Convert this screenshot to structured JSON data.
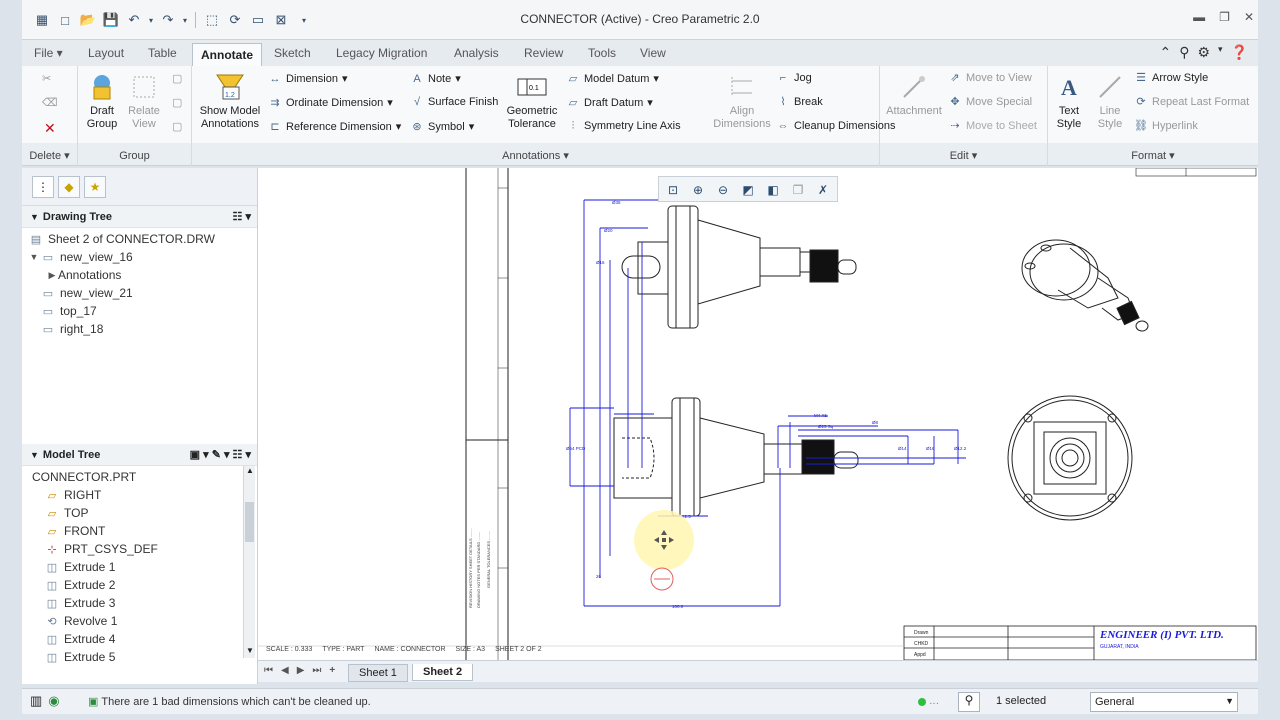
{
  "window": {
    "title": "CONNECTOR (Active) - Creo Parametric 2.0"
  },
  "tabs": [
    "File",
    "Layout",
    "Table",
    "Annotate",
    "Sketch",
    "Legacy Migration",
    "Analysis",
    "Review",
    "Tools",
    "View"
  ],
  "ribbon": {
    "delete_group": {
      "label": "Delete"
    },
    "group_group": {
      "label": "Group",
      "draft_group": "Draft Group",
      "relate_view": "Relate View"
    },
    "annotations_group": {
      "label": "Annotations",
      "show_model_annotations": "Show Model Annotations",
      "dimension": "Dimension",
      "ordinate_dimension": "Ordinate Dimension",
      "reference_dimension": "Reference Dimension",
      "note": "Note",
      "surface_finish": "Surface Finish",
      "symbol": "Symbol",
      "geometric_tolerance": "Geometric Tolerance",
      "model_datum": "Model Datum",
      "draft_datum": "Draft Datum",
      "symmetry_line_axis": "Symmetry Line Axis",
      "align_dimensions": "Align Dimensions",
      "jog": "Jog",
      "break": "Break",
      "cleanup_dimensions": "Cleanup Dimensions"
    },
    "edit_group": {
      "label": "Edit",
      "attachment": "Attachment",
      "move_to_view": "Move to View",
      "move_special": "Move Special",
      "move_to_sheet": "Move to Sheet"
    },
    "format_group": {
      "label": "Format",
      "text_style": "Text Style",
      "line_style": "Line Style",
      "arrow_style": "Arrow Style",
      "repeat_last_format": "Repeat Last Format",
      "hyperlink": "Hyperlink"
    }
  },
  "drawing_tree": {
    "title": "Drawing Tree",
    "items": [
      "Sheet 2 of CONNECTOR.DRW",
      "new_view_16",
      "Annotations",
      "new_view_21",
      "top_17",
      "right_18"
    ]
  },
  "model_tree": {
    "title": "Model Tree",
    "root": "CONNECTOR.PRT",
    "items": [
      "RIGHT",
      "TOP",
      "FRONT",
      "PRT_CSYS_DEF",
      "Extrude 1",
      "Extrude 2",
      "Extrude 3",
      "Revolve 1",
      "Extrude 4",
      "Extrude 5"
    ]
  },
  "drawing": {
    "footer_scale": "SCALE : 0.333",
    "footer_type": "TYPE : PART",
    "footer_name": "NAME : CONNECTOR",
    "footer_size": "SIZE : A3",
    "footer_sheet": "SHEET 2 OF 2",
    "company": "ENGINEER (I) PVT. LTD.",
    "company_sub": "GUJARAT, INDIA",
    "title_rows": [
      "Drawn",
      "CHKD",
      "Appd"
    ]
  },
  "sheets": {
    "tabs": [
      "Sheet 1",
      "Sheet 2"
    ],
    "active": "Sheet 2"
  },
  "status": {
    "message": "There are 1 bad dimensions which can't be cleaned up.",
    "selection": "1 selected",
    "filter": "General"
  },
  "colors": {
    "dimension_blue": "#1a1adb",
    "ribbon_bg": "#f7f9fb",
    "frame": "#dde3ea"
  }
}
